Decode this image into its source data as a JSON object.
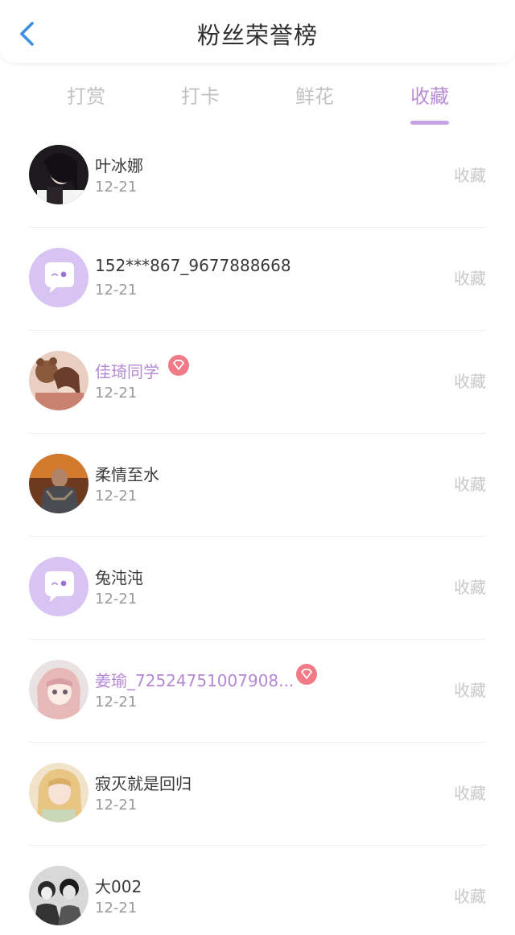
{
  "header": {
    "title": "粉丝荣誉榜",
    "back_icon": "chevron-left-icon",
    "accent": "#3a8ee6"
  },
  "tabs": [
    {
      "label": "打赏",
      "active": false
    },
    {
      "label": "打卡",
      "active": false
    },
    {
      "label": "鲜花",
      "active": false
    },
    {
      "label": "收藏",
      "active": true
    }
  ],
  "colors": {
    "active_tab": "#b98cd8",
    "vip_name": "#b488d3",
    "badge": "#f07a85",
    "default_avatar_bg": "#d7c4f2"
  },
  "fans": [
    {
      "name": "叶冰娜",
      "date": "12-21",
      "action": "收藏",
      "vip": false,
      "avatar": "photo-girl-dark-hair"
    },
    {
      "name": "152***867_9677888668",
      "date": "12-21",
      "action": "收藏",
      "vip": false,
      "avatar": "default-chat-bubble"
    },
    {
      "name": "佳琦同学",
      "date": "12-21",
      "action": "收藏",
      "vip": true,
      "avatar": "photo-girl-teddy-bear"
    },
    {
      "name": "柔情至水",
      "date": "12-21",
      "action": "收藏",
      "vip": false,
      "avatar": "photo-armored-warrior"
    },
    {
      "name": "兔沌沌",
      "date": "12-21",
      "action": "收藏",
      "vip": false,
      "avatar": "default-chat-bubble"
    },
    {
      "name": "姜瑜_72524751007908...",
      "date": "12-21",
      "action": "收藏",
      "vip": true,
      "avatar": "anime-girl-pink-hair"
    },
    {
      "name": "寂灭就是回归",
      "date": "12-21",
      "action": "收藏",
      "vip": false,
      "avatar": "photo-girl-blonde"
    },
    {
      "name": "大002",
      "date": "12-21",
      "action": "收藏",
      "vip": false,
      "avatar": "photo-black-white-group"
    }
  ]
}
